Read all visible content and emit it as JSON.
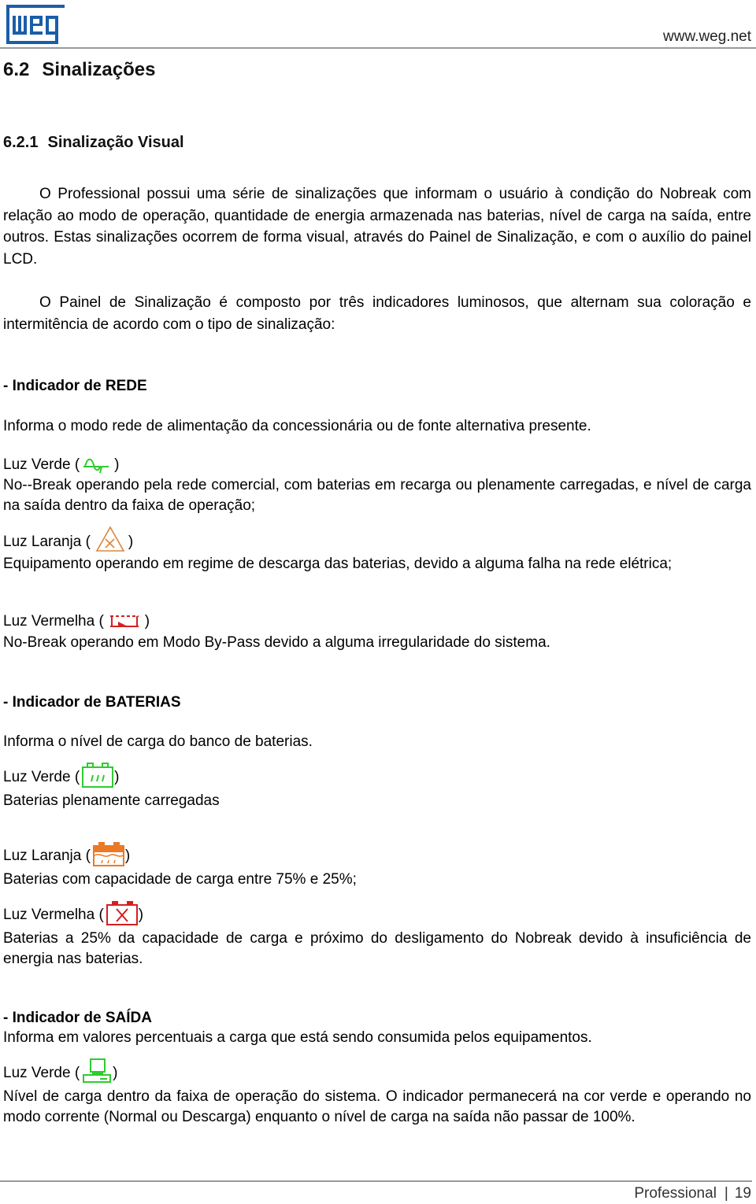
{
  "header": {
    "logo_text": "weg",
    "url": "www.weg.net",
    "brand_color": "#1a5ea8"
  },
  "section": {
    "number": "6.2",
    "title": "Sinalizações"
  },
  "subsection": {
    "number": "6.2.1",
    "title": "Sinalização Visual"
  },
  "intro": {
    "paragraph1": "O Professional possui uma série de sinalizações que informam o usuário à condição do Nobreak com relação ao modo de operação, quantidade de energia armazenada nas baterias, nível de carga na saída, entre outros. Estas sinalizações ocorrem de forma visual, através do Painel de Sinalização, e com o auxílio do painel LCD.",
    "paragraph2": "O Painel de Sinalização é composto por três indicadores luminosos, que alternam sua coloração e intermitência de acordo com o tipo de sinalização:"
  },
  "indicators": [
    {
      "heading": "- Indicador de REDE",
      "description": "Informa o modo rede de alimentação da concessionária ou de fonte alternativa presente.",
      "lights": [
        {
          "label": "Luz Verde (",
          "close": ")",
          "icon": "ac-sine-wave-icon",
          "color": "#2ecc2e",
          "text": "No--Break operando pela rede comercial, com baterias em recarga ou plenamente carregadas, e nível de carga na saída dentro da faixa de operação;"
        },
        {
          "label": "Luz Laranja (",
          "close": ")",
          "icon": "warning-triangle-icon",
          "color": "#d9873a",
          "text": "Equipamento operando em regime de descarga das baterias, devido a alguma falha na rede elétrica;"
        },
        {
          "label": "Luz Vermelha (",
          "close": ")",
          "icon": "bypass-icon",
          "color": "#d42020",
          "text": "No-Break operando em Modo By-Pass devido a alguma irregularidade do sistema."
        }
      ]
    },
    {
      "heading": "- Indicador de BATERIAS",
      "description": "Informa o nível de carga do banco de baterias.",
      "lights": [
        {
          "label": "Luz Verde (",
          "close": ")",
          "icon": "battery-full-icon",
          "color": "#2ecc2e",
          "text": "Baterias plenamente carregadas"
        },
        {
          "label": "Luz Laranja (",
          "close": ")",
          "icon": "battery-partial-icon",
          "color": "#ea7a25",
          "text": "Baterias com capacidade de carga entre 75% e 25%;"
        },
        {
          "label": "Luz Vermelha (",
          "close": ")",
          "icon": "battery-empty-icon",
          "color": "#d42020",
          "text": "Baterias a 25% da capacidade de carga e próximo do desligamento do Nobreak devido à insuficiência de energia nas baterias."
        }
      ]
    },
    {
      "heading": "- Indicador de SAÍDA",
      "description": "Informa em valores percentuais a carga que está sendo consumida pelos equipamentos.",
      "lights": [
        {
          "label": "Luz Verde (",
          "close": ")",
          "icon": "computer-load-icon",
          "color": "#2ecc2e",
          "text": "Nível de carga dentro da faixa de operação do sistema. O indicador permanecerá na cor verde e operando no modo corrente (Normal ou Descarga) enquanto o nível de carga na saída não passar de 100%."
        }
      ]
    }
  ],
  "footer": {
    "product": "Professional",
    "separator": "|",
    "page_number": "19"
  }
}
